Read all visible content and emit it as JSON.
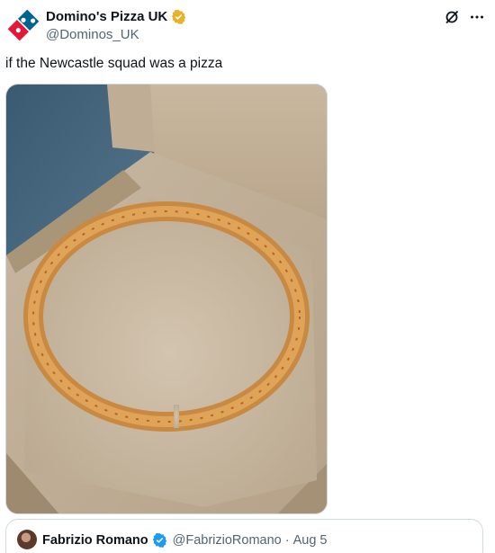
{
  "tweet": {
    "author": {
      "name": "Domino's Pizza UK",
      "handle": "@Dominos_UK",
      "verified_color": "#e8b32a"
    },
    "text": "if the Newcastle squad was a pizza",
    "media": {
      "alt_icon": "pizza-photo"
    },
    "icons": {
      "grok": "grok-icon",
      "more": "more-icon"
    }
  },
  "quoted_tweet": {
    "name": "Fabrizio Romano",
    "handle": "@FabrizioRomano",
    "separator": "·",
    "date": "Aug 5",
    "verified_color": "#1d9bf0"
  }
}
